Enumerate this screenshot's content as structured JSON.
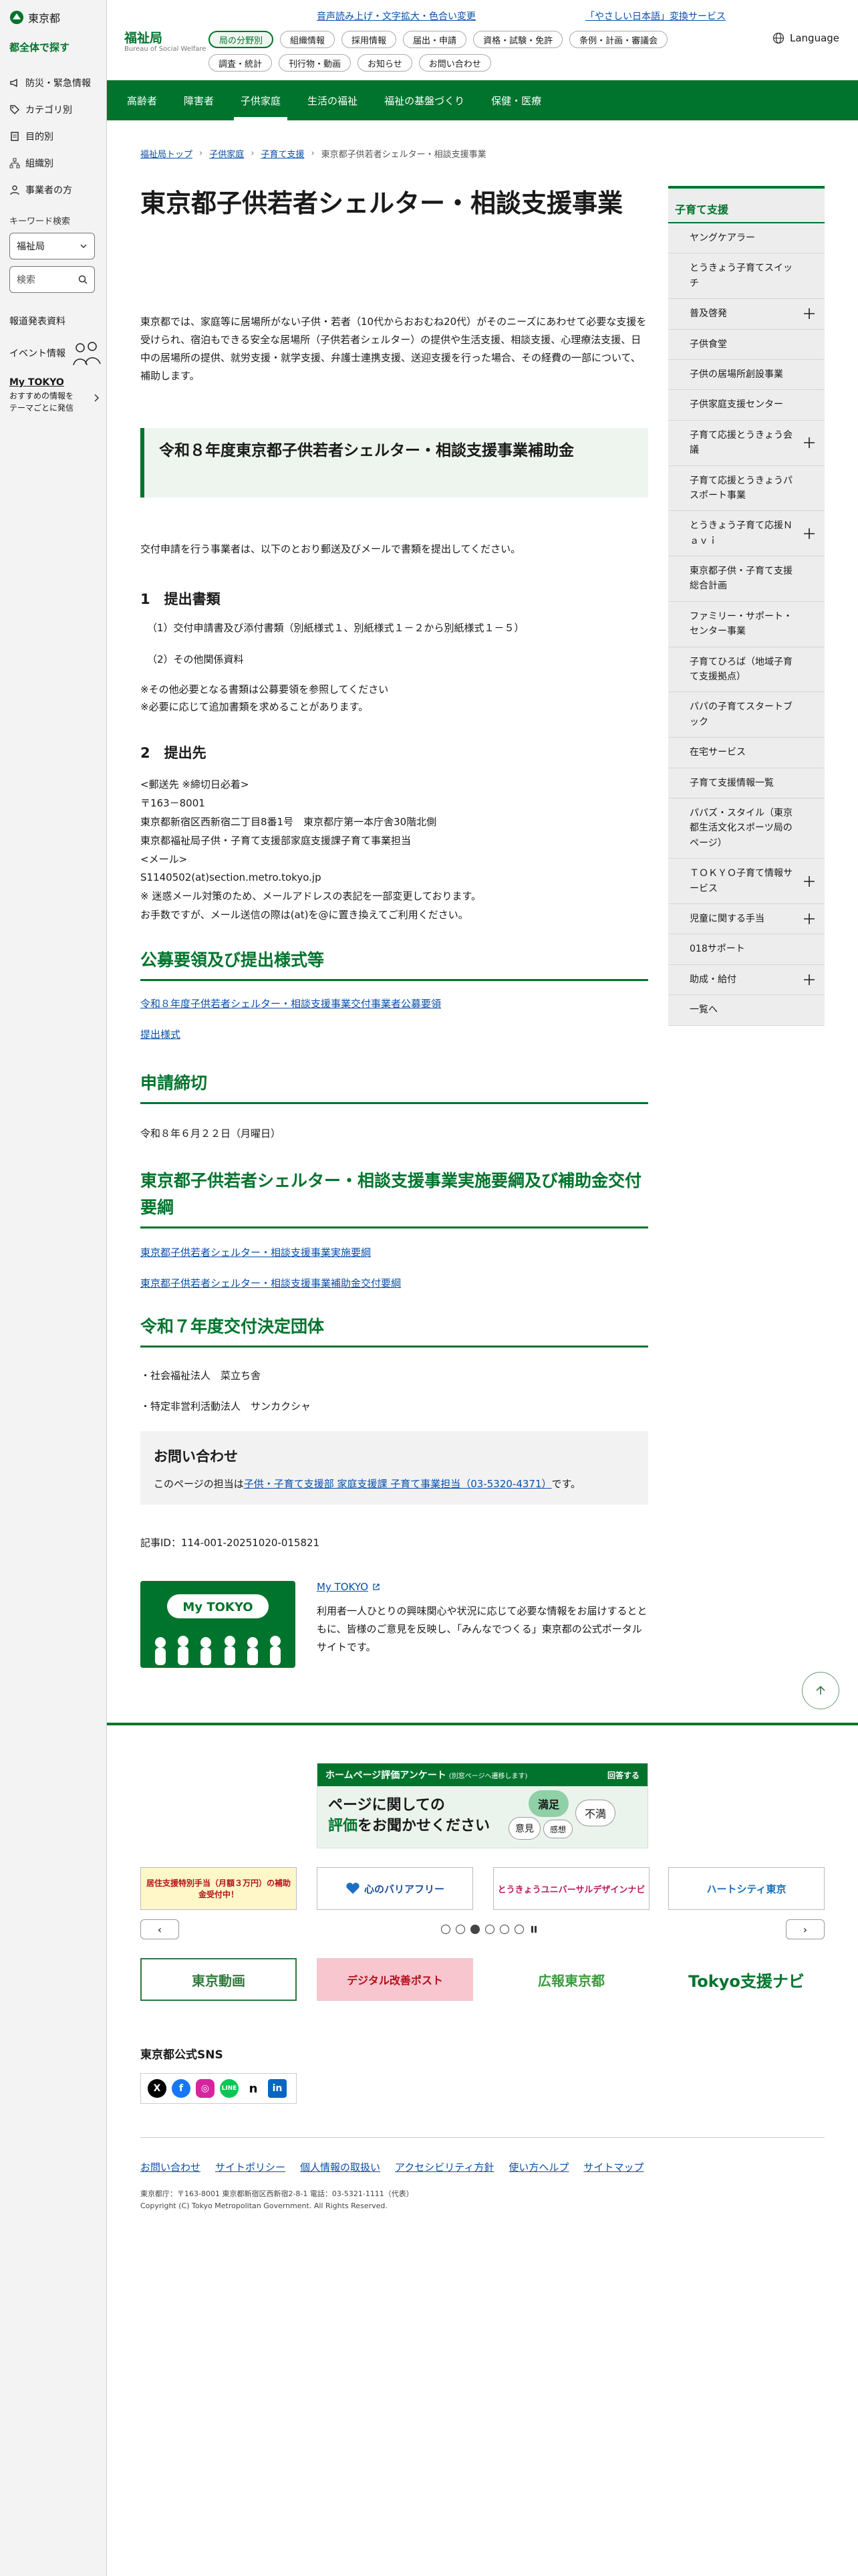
{
  "sidebar": {
    "logo": "東京都",
    "all_search": "都全体で探す",
    "menu": [
      {
        "label": "防災・緊急情報",
        "icon": "megaphone-icon"
      },
      {
        "label": "カテゴリ別",
        "icon": "tag-icon"
      },
      {
        "label": "目的別",
        "icon": "document-icon"
      },
      {
        "label": "組織別",
        "icon": "org-chart-icon"
      },
      {
        "label": "事業者の方",
        "icon": "person-icon"
      }
    ],
    "keyword_label": "キーワード検索",
    "keyword_select": "福祉局",
    "search_placeholder": "検索",
    "report": "報道発表資料",
    "event": "イベント情報",
    "mytokyo_title": "My TOKYO",
    "mytokyo_desc": "おすすめの情報を\nテーマごとに発信"
  },
  "header": {
    "bureau": "福祉局",
    "bureau_en": "Bureau of Social Welfare",
    "util1": "音声読み上げ・文字拡大・色合い変更",
    "util2": "「やさしい日本語」変換サービス",
    "language": "Language",
    "chips": [
      "局の分野別",
      "組織情報",
      "採用情報",
      "届出・申請",
      "資格・試験・免許",
      "条例・計画・審議会",
      "調査・統計",
      "刊行物・動画",
      "お知らせ",
      "お問い合わせ"
    ]
  },
  "gnav": [
    "高齢者",
    "障害者",
    "子供家庭",
    "生活の福祉",
    "福祉の基盤づくり",
    "保健・医療"
  ],
  "breadcrumb": [
    "福祉局トップ",
    "子供家庭",
    "子育て支援",
    "東京都子供若者シェルター・相談支援事業"
  ],
  "main": {
    "title": "東京都子供若者シェルター・相談支援事業",
    "intro": "東京都では、家庭等に居場所がない子供・若者（10代からおおむね20代）がそのニーズにあわせて必要な支援を受けられ、宿泊もできる安全な居場所（子供若者シェルター）の提供や生活支援、相談支援、心理療法支援、日中の居場所の提供、就労支援・就学支援、弁護士連携支援、送迎支援を行った場合、その経費の一部について、補助します。",
    "h2": "令和８年度東京都子供若者シェルター・相談支援事業補助金",
    "p1": "交付申請を行う事業者は、以下のとおり郵送及びメールで書類を提出してください。",
    "h3a": "1　提出書類",
    "l1": "（1）交付申請書及び添付書類（別紙様式１、別紙様式１－２から別紙様式１－５）",
    "l2": "（2）その他関係資料",
    "n1": "※その他必要となる書類は公募要領を参照してください",
    "n2": "※必要に応じて追加書類を求めることがあります。",
    "h3b": "2　提出先",
    "addr": "<郵送先 ※締切日必着>\n〒163－8001\n東京都新宿区西新宿二丁目8番1号　東京都庁第一本庁舎30階北側\n東京都福祉局子供・子育て支援部家庭支援課子育て事業担当\n<メール>\nS1140502(at)section.metro.tokyo.jp\n※ 迷惑メール対策のため、メールアドレスの表記を一部変更しております。\nお手数ですが、メール送信の際は(at)を@に置き換えてご利用ください。",
    "h2g1": "公募要領及び提出様式等",
    "lk1": "令和８年度子供若者シェルター・相談支援事業交付事業者公募要領",
    "lk2": "提出様式",
    "h2g2": "申請締切",
    "deadline": "令和８年６月２２日（月曜日）",
    "h2g3": "東京都子供若者シェルター・相談支援事業実施要綱及び補助金交付要綱",
    "lk3": "東京都子供若者シェルター・相談支援事業実施要綱",
    "lk4": "東京都子供若者シェルター・相談支援事業補助金交付要綱",
    "h2g4": "令和７年度交付決定団体",
    "org1": "・社会福祉法人　菜立ち舎",
    "org2": "・特定非営利活動法人　サンカクシャ",
    "inq_title": "お問い合わせ",
    "inq_pre": "このページの担当は",
    "inq_link": "子供・子育て支援部 家庭支援課 子育て事業担当（03-5320-4371）",
    "inq_post": "です。",
    "article_id": "記事ID：114-001-20251020-015821",
    "mt_banner": "My TOKYO",
    "mt_link": "My TOKYO",
    "mt_desc": "利用者一人ひとりの興味関心や状況に応じて必要な情報をお届けするとともに、皆様のご意見を反映し、「みんなでつくる」東京都の公式ポータルサイトです。"
  },
  "side_nav": {
    "head": "子育て支援",
    "items": [
      {
        "label": "ヤングケアラー",
        "plus": false
      },
      {
        "label": "とうきょう子育てスイッチ",
        "plus": false
      },
      {
        "label": "普及啓発",
        "plus": true
      },
      {
        "label": "子供食堂",
        "plus": false
      },
      {
        "label": "子供の居場所創設事業",
        "plus": false
      },
      {
        "label": "子供家庭支援センター",
        "plus": false
      },
      {
        "label": "子育て応援とうきょう会議",
        "plus": true
      },
      {
        "label": "子育て応援とうきょうパスポート事業",
        "plus": false
      },
      {
        "label": "とうきょう子育て応援Ｎａｖｉ",
        "plus": true
      },
      {
        "label": "東京都子供・子育て支援総合計画",
        "plus": false
      },
      {
        "label": "ファミリー・サポート・センター事業",
        "plus": false
      },
      {
        "label": "子育てひろば（地域子育て支援拠点）",
        "plus": false
      },
      {
        "label": "パパの子育てスタートブック",
        "plus": false
      },
      {
        "label": "在宅サービス",
        "plus": false
      },
      {
        "label": "子育て支援情報一覧",
        "plus": false
      },
      {
        "label": "パパズ・スタイル（東京都生活文化スポーツ局のページ）",
        "plus": false
      },
      {
        "label": "ＴＯＫＹＯ子育て情報サービス",
        "plus": true
      },
      {
        "label": "児童に関する手当",
        "plus": true
      },
      {
        "label": "018サポート",
        "plus": false
      },
      {
        "label": "助成・給付",
        "plus": true
      },
      {
        "label": "一覧へ",
        "plus": false
      }
    ]
  },
  "footer": {
    "survey_bar": "ホームページ評価アンケート",
    "survey_bar_small": "(別窓ページへ遷移します)",
    "survey_answer": "回答する",
    "survey_line1": "ページに関しての",
    "survey_line2a": "評価",
    "survey_line2b": "をお聞かせください",
    "survey_words": [
      "満足",
      "意見",
      "感想",
      "不満"
    ],
    "banners": [
      "居住支援特別手当（月額３万円）の補助金受付中！",
      "心のバリアフリー",
      "とうきょうユニバーサルデザインナビ",
      "ハートシティ東京"
    ],
    "prev": "‹",
    "next": "›",
    "portals": [
      "東京動画",
      "デジタル改善ポスト",
      "広報東京都",
      "Tokyo支援ナビ"
    ],
    "sns_title": "東京都公式SNS",
    "links": [
      "お問い合わせ",
      "サイトポリシー",
      "個人情報の取扱い",
      "アクセシビリティ方針",
      "使い方ヘルプ",
      "サイトマップ"
    ],
    "address": "東京都庁：〒163-8001 東京都新宿区西新宿2-8-1 電話：03-5321-1111（代表）",
    "copyright": "Copyright (C) Tokyo Metropolitan Government. All Rights Reserved."
  },
  "colors": {
    "brand": "#00742d",
    "link": "#0a4fa8"
  }
}
